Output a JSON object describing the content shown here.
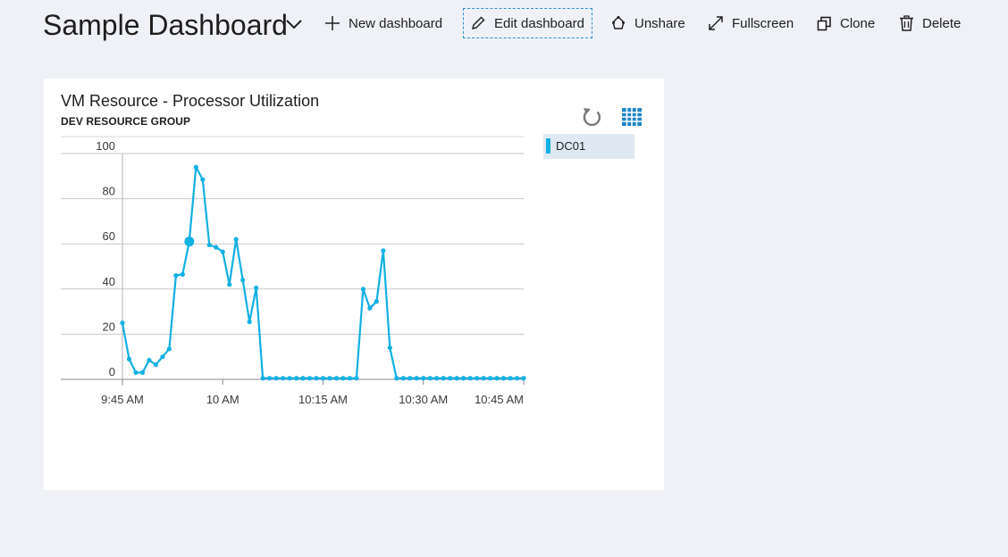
{
  "header": {
    "title": "Sample Dashboard",
    "actions": {
      "new_dashboard": "New dashboard",
      "edit_dashboard": "Edit dashboard",
      "unshare": "Unshare",
      "fullscreen": "Fullscreen",
      "clone": "Clone",
      "delete": "Delete"
    }
  },
  "tile": {
    "title": "VM Resource - Processor Utilization",
    "subtitle": "DEV RESOURCE GROUP",
    "legend": [
      {
        "label": "DC01",
        "color": "#12b0e3"
      }
    ]
  },
  "icons": [
    "chevron-down-icon",
    "plus-icon",
    "pencil-icon",
    "unshare-icon",
    "expand-icon",
    "clone-icon",
    "trash-icon",
    "refresh-icon",
    "grid-icon"
  ],
  "colors": {
    "accent": "#2a8fd0",
    "series": "#12b0e3",
    "background": "#eff1f6"
  },
  "chart_data": {
    "type": "line",
    "title": "",
    "xlabel": "",
    "ylabel": "",
    "x_ticks": [
      "9:45 AM",
      "10 AM",
      "10:15 AM",
      "10:30 AM",
      "10:45 AM"
    ],
    "x_tick_minutes": [
      0,
      15,
      30,
      45,
      60
    ],
    "y_ticks": [
      0,
      20,
      40,
      60,
      80,
      100
    ],
    "ylim": [
      0,
      100
    ],
    "grid": true,
    "legend_position": "right",
    "series": [
      {
        "name": "DC01",
        "color": "#12b0e3",
        "points": [
          [
            0,
            25
          ],
          [
            1,
            9
          ],
          [
            2,
            3
          ],
          [
            3,
            3
          ],
          [
            4,
            8.5
          ],
          [
            5,
            6.5
          ],
          [
            6,
            10
          ],
          [
            7,
            13.5
          ],
          [
            8,
            46
          ],
          [
            9,
            46.5
          ],
          [
            10,
            61
          ],
          [
            11,
            94
          ],
          [
            12,
            88.5
          ],
          [
            13,
            59.5
          ],
          [
            14,
            58.5
          ],
          [
            15,
            56.5
          ],
          [
            16,
            42
          ],
          [
            17,
            62
          ],
          [
            18,
            44
          ],
          [
            19,
            25.5
          ],
          [
            20,
            40.5
          ],
          [
            21,
            0.5
          ],
          [
            22,
            0.5
          ],
          [
            23,
            0.5
          ],
          [
            24,
            0.5
          ],
          [
            25,
            0.5
          ],
          [
            26,
            0.5
          ],
          [
            27,
            0.5
          ],
          [
            28,
            0.5
          ],
          [
            29,
            0.5
          ],
          [
            30,
            0.5
          ],
          [
            31,
            0.5
          ],
          [
            32,
            0.5
          ],
          [
            33,
            0.5
          ],
          [
            34,
            0.5
          ],
          [
            35,
            0.5
          ],
          [
            36,
            40
          ],
          [
            37,
            31.5
          ],
          [
            38,
            34.5
          ],
          [
            39,
            57
          ],
          [
            40,
            14
          ],
          [
            41,
            0.5
          ],
          [
            42,
            0.5
          ],
          [
            43,
            0.5
          ],
          [
            44,
            0.5
          ],
          [
            45,
            0.5
          ],
          [
            46,
            0.5
          ],
          [
            47,
            0.5
          ],
          [
            48,
            0.5
          ],
          [
            49,
            0.5
          ],
          [
            50,
            0.5
          ],
          [
            51,
            0.5
          ],
          [
            52,
            0.5
          ],
          [
            53,
            0.5
          ],
          [
            54,
            0.5
          ],
          [
            55,
            0.5
          ],
          [
            56,
            0.5
          ],
          [
            57,
            0.5
          ],
          [
            58,
            0.5
          ],
          [
            59,
            0.5
          ],
          [
            60,
            0.5
          ]
        ],
        "highlight_x": 10
      }
    ]
  }
}
